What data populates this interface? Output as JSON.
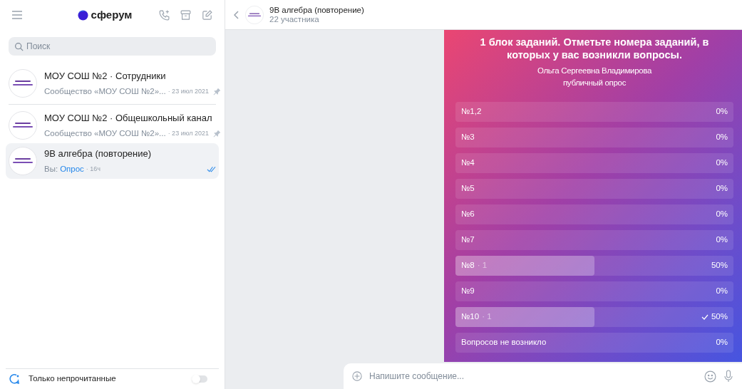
{
  "sidebar": {
    "logo": "сферум",
    "search": {
      "placeholder": "Поиск"
    },
    "chats": [
      {
        "title": "МОУ СОШ №2 · Сотрудники",
        "preview": "Сообщество «МОУ СОШ №2»...",
        "time": "· 23 июл 2021",
        "pinned": true,
        "read": false,
        "selected": false,
        "divider_after": true
      },
      {
        "title": "МОУ СОШ №2 · Общешкольный канал",
        "preview": "Сообщество «МОУ СОШ №2»...",
        "time": "· 23 июл 2021",
        "pinned": true,
        "read": false,
        "selected": false,
        "divider_after": false
      },
      {
        "title": "9В алгебра (повторение)",
        "preview": "Вы:",
        "preview_link": "Опрос",
        "time": "· 16ч",
        "pinned": false,
        "read": true,
        "selected": true,
        "divider_after": false
      }
    ],
    "unread_filter": {
      "label": "Только непрочитанные",
      "on": false
    }
  },
  "chat": {
    "title": "9В алгебра (повторение)",
    "subtitle": "22 участника",
    "poll": {
      "title": "1 блок заданий. Отметьте номера заданий, в которых у вас возникли вопросы.",
      "author": "Ольга Сергеевна Владимирова",
      "type": "публичный опрос",
      "options": [
        {
          "label": "№1,2",
          "percent": "0%",
          "level": 0,
          "checked": false
        },
        {
          "label": "№3",
          "percent": "0%",
          "level": 0,
          "checked": false
        },
        {
          "label": "№4",
          "percent": "0%",
          "level": 0,
          "checked": false
        },
        {
          "label": "№5",
          "percent": "0%",
          "level": 0,
          "checked": false
        },
        {
          "label": "№6",
          "percent": "0%",
          "level": 0,
          "checked": false
        },
        {
          "label": "№7",
          "percent": "0%",
          "level": 0,
          "checked": false
        },
        {
          "label": "№8",
          "count": "· 1",
          "percent": "50%",
          "level": 0.5,
          "checked": false
        },
        {
          "label": "№9",
          "percent": "0%",
          "level": 0,
          "checked": false
        },
        {
          "label": "№10",
          "count": "· 1",
          "percent": "50%",
          "level": 0.5,
          "checked": true
        },
        {
          "label": "Вопросов не возникло",
          "percent": "0%",
          "level": 0,
          "checked": false
        }
      ]
    },
    "composer": {
      "placeholder": "Напишите сообщение..."
    }
  }
}
